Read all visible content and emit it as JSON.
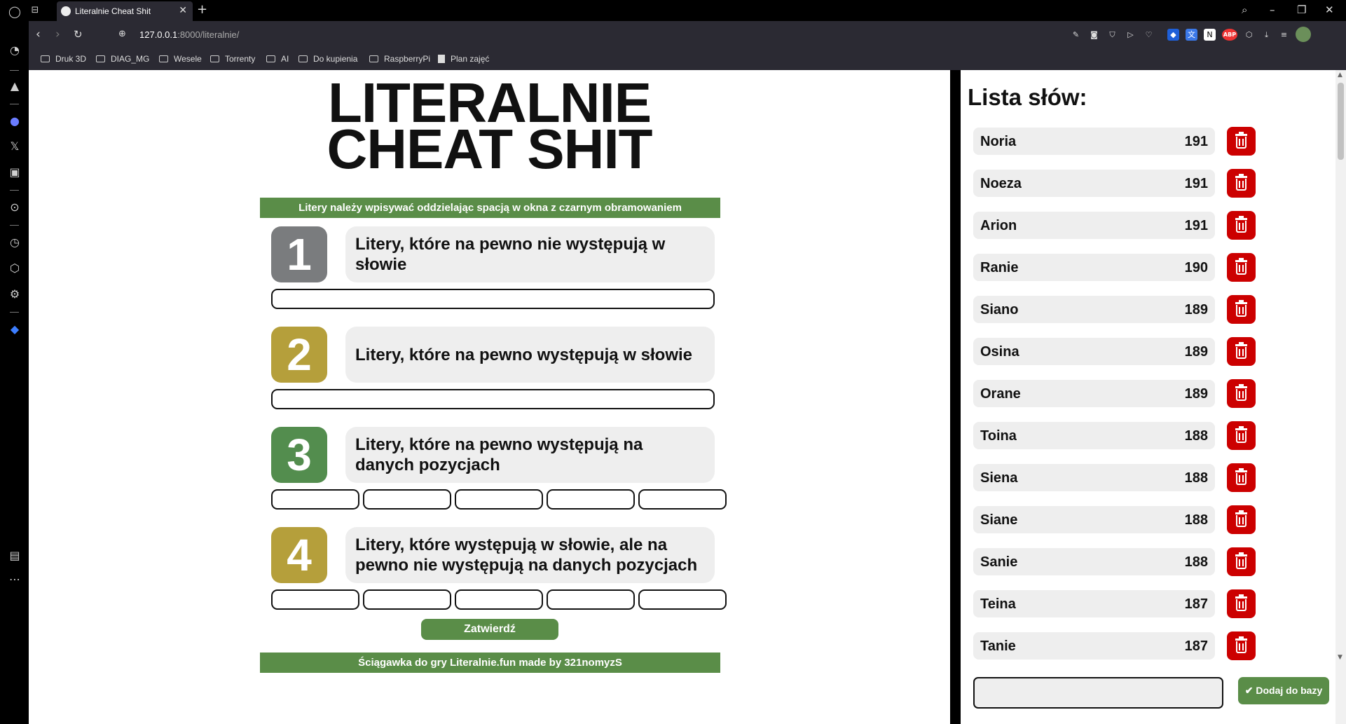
{
  "browser": {
    "tab_title": "Literalnie Cheat Shit",
    "url_host": "127.0.0.1",
    "url_path": ":8000/literalnie/",
    "bookmarks": [
      {
        "label": "Druk 3D",
        "type": "folder"
      },
      {
        "label": "DIAG_MG",
        "type": "folder"
      },
      {
        "label": "Wesele",
        "type": "folder"
      },
      {
        "label": "Torrenty",
        "type": "folder"
      },
      {
        "label": "AI",
        "type": "folder"
      },
      {
        "label": "Do kupienia",
        "type": "folder"
      },
      {
        "label": "RaspberryPi",
        "type": "folder"
      },
      {
        "label": "Plan zajęć",
        "type": "page"
      }
    ],
    "extensions": {
      "abp": "ABP"
    }
  },
  "main": {
    "logo_line1": "LITERALNIE",
    "logo_line2": "CHEAT SHIT",
    "instruction": "Litery należy wpisywać oddzielając spacją w okna z czarnym obramowaniem",
    "sections": [
      {
        "number": "1",
        "label": "Litery, które na pewno nie występują w słowie",
        "color": "#808080",
        "inputs": 1
      },
      {
        "number": "2",
        "label": "Litery, które na pewno występują w słowie",
        "color": "#b59f3b",
        "inputs": 1
      },
      {
        "number": "3",
        "label": "Litery, które na pewno występują na danych pozycjach",
        "color": "#538d4e",
        "inputs": 5
      },
      {
        "number": "4",
        "label": "Litery, które występują w słowie, ale na pewno nie występują na danych pozycjach",
        "color": "#b59f3b",
        "inputs": 5
      }
    ],
    "submit_label": "Zatwierdź",
    "footer": "Ściągawka do gry Literalnie.fun made by 321nomyzS"
  },
  "words_panel": {
    "title": "Lista słów:",
    "words": [
      {
        "word": "Noria",
        "score": "191"
      },
      {
        "word": "Noeza",
        "score": "191"
      },
      {
        "word": "Arion",
        "score": "191"
      },
      {
        "word": "Ranie",
        "score": "190"
      },
      {
        "word": "Siano",
        "score": "189"
      },
      {
        "word": "Osina",
        "score": "189"
      },
      {
        "word": "Orane",
        "score": "189"
      },
      {
        "word": "Toina",
        "score": "188"
      },
      {
        "word": "Siena",
        "score": "188"
      },
      {
        "word": "Siane",
        "score": "188"
      },
      {
        "word": "Sanie",
        "score": "188"
      },
      {
        "word": "Teina",
        "score": "187"
      },
      {
        "word": "Tanie",
        "score": "187"
      }
    ],
    "add_button": "Dodaj do bazy",
    "new_word_value": ""
  },
  "colors": {
    "green": "#5a8d48",
    "delete_red": "#cc0000",
    "gray_badge": "#808080",
    "yellow_badge": "#b59f3b"
  }
}
